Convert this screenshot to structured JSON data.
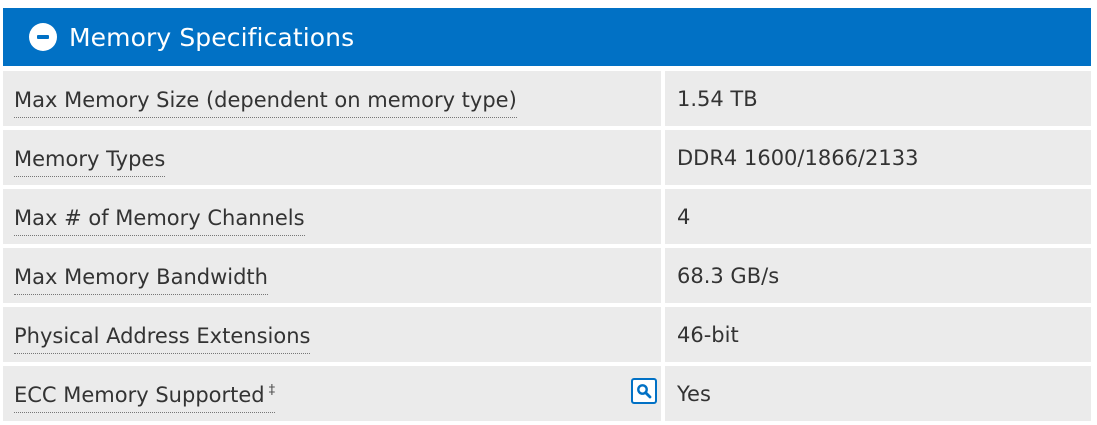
{
  "section": {
    "title": "Memory Specifications",
    "toggle_icon": "minus-circle-icon",
    "accent_color": "#0171c5",
    "row_background": "#ebebeb"
  },
  "rows": [
    {
      "label": "Max Memory Size (dependent on memory type)",
      "value": "1.54 TB"
    },
    {
      "label": "Memory Types",
      "value": "DDR4 1600/1866/2133"
    },
    {
      "label": "Max # of Memory Channels",
      "value": "4"
    },
    {
      "label": "Max Memory Bandwidth",
      "value": "68.3 GB/s"
    },
    {
      "label": "Physical Address Extensions",
      "value": "46-bit"
    },
    {
      "label": "ECC Memory Supported",
      "footnote": "‡",
      "value": "Yes",
      "search_icon": "search-icon"
    }
  ]
}
